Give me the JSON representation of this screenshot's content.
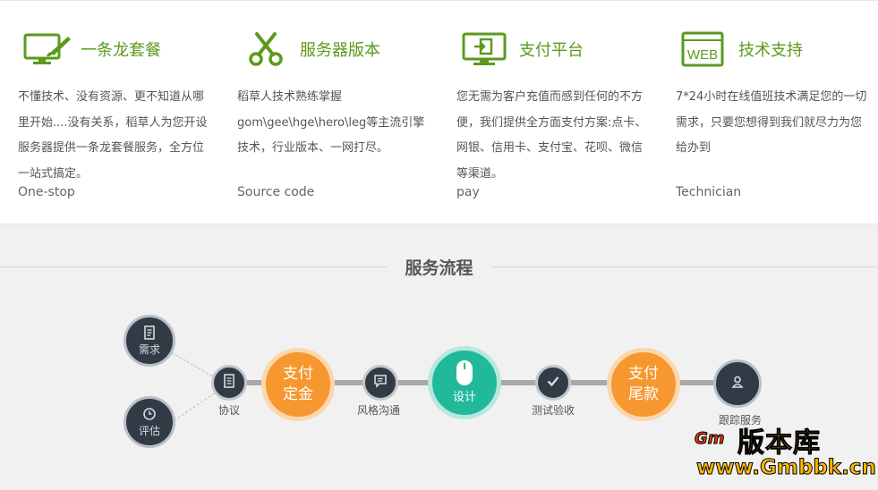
{
  "features": [
    {
      "icon": "monitor-brush-icon",
      "title": "一条龙套餐",
      "desc": "不懂技术、没有资源、更不知道从哪里开始....没有关系，稻草人为您开设服务器提供一条龙套餐服务，全方位一站式搞定。",
      "en": "One-stop"
    },
    {
      "icon": "scissors-icon",
      "title": "服务器版本",
      "desc": "稻草人技术熟练掌握gom\\gee\\hge\\hero\\leg等主流引擎技术，行业版本、一网打尽。",
      "en": "Source code"
    },
    {
      "icon": "monitor-login-icon",
      "title": "支付平台",
      "desc": "您无需为客户充值而感到任何的不方便，我们提供全方面支付方案:点卡、网银、信用卡、支付宝、花呗、微信等渠道。",
      "en": "pay"
    },
    {
      "icon": "web-window-icon",
      "icon_text": "WEB",
      "title": "技术支持",
      "desc": "7*24小时在线值班技术满足您的一切需求，只要您想得到我们就尽力为您给办到",
      "en": "Technician"
    }
  ],
  "flow": {
    "title": "服务流程",
    "steps": {
      "demand": "需求",
      "estimate": "评估",
      "agreement": "协议",
      "deposit": "支付定金",
      "style": "风格沟通",
      "design": "设计",
      "test": "测试验收",
      "final": "支付尾款",
      "follow": "跟踪服务"
    }
  },
  "watermark": {
    "name": "版本库",
    "url": "www.Gmbbk.cn",
    "logo": "Gm"
  },
  "colors": {
    "green": "#5b9a1d",
    "orange": "#f7972f",
    "teal": "#22b99b",
    "dark": "#323a45"
  }
}
